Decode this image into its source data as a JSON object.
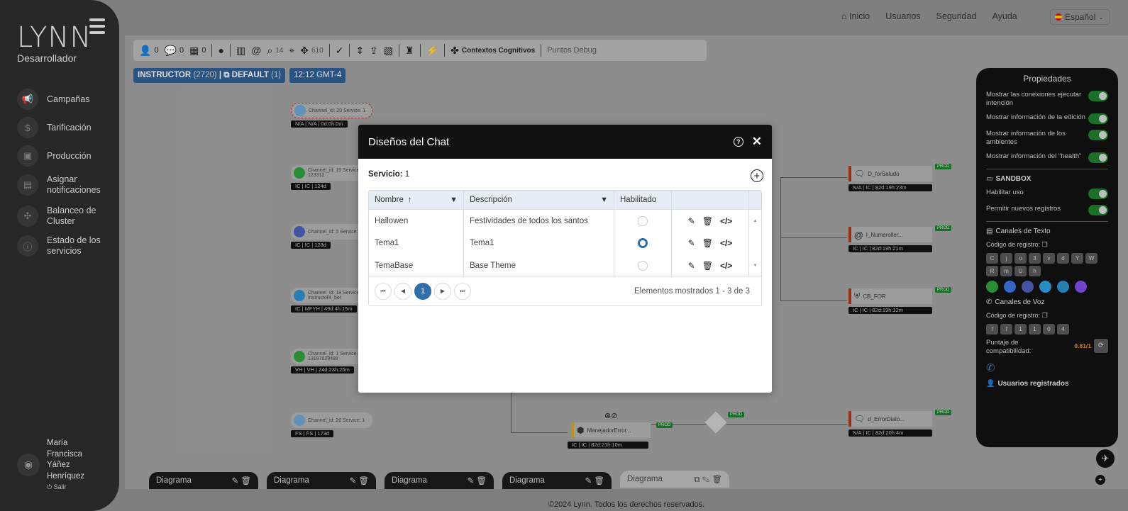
{
  "sidebar": {
    "logo": "LYNN",
    "role": "Desarrollador",
    "items": [
      {
        "label": "Campañas"
      },
      {
        "label": "Tarificación"
      },
      {
        "label": "Producción"
      },
      {
        "label": "Asignar notificaciones"
      },
      {
        "label": "Balanceo de Cluster"
      },
      {
        "label": "Estado de los servicios"
      }
    ],
    "user": {
      "name": "María Francisca Yáñez Henríquez",
      "logout": "Salir"
    }
  },
  "topnav": {
    "items": [
      "Inicio",
      "Usuarios",
      "Seguridad",
      "Ayuda"
    ],
    "language": "Español"
  },
  "toolbar": {
    "counters": [
      "0",
      "0",
      "0"
    ],
    "search_count": "14",
    "plugin_count": "610",
    "cognitive_contexts": "Contextos Cognitivos",
    "debug_points": "Puntos Debug"
  },
  "badges": {
    "instructor": "INSTRUCTOR",
    "instructor_id": "(2720)",
    "default": "DEFAULT",
    "default_id": "(1)",
    "time": "12:12 GMT-4"
  },
  "diagram": {
    "nodes": [
      {
        "label": "Channel_id: 20 Service: 1",
        "status": "N/A | N/A | 0d:0h:0m"
      },
      {
        "label": "Channel_id: 15 Service",
        "sub": "123312",
        "status": "IC | IC | 124d"
      },
      {
        "label": "Channel_id: 3 Service:",
        "status": "IC | IC | 123d"
      },
      {
        "label": "Channel_id: 18 Service",
        "sub": "Instructor4_bot",
        "status": "IC | MFYH | 49d:4h:15m"
      },
      {
        "label": "Channel_id: 1 Service:",
        "sub": "13197029488",
        "status": "VH | VH | 24d:23h:25m"
      },
      {
        "label": "Channel_id: 20 Service: 1",
        "status": "FS | FS | 173d"
      }
    ],
    "right_nodes": [
      {
        "label": "D_forSaludo",
        "status": "N/A | IC | 82d:19h:23m",
        "env": "PROD"
      },
      {
        "label": "I_Numeroller...",
        "status": "IC | IC | 82d:19h:21m",
        "env": "PROD"
      },
      {
        "label": "CB_FOR",
        "status": "IC | IC | 82d:19h:12m",
        "env": "PROD"
      },
      {
        "label": "d_ErrorDialo...",
        "status": "N/A | IC | 82d:20h:4m",
        "env": "PROD"
      }
    ],
    "error_node": {
      "label": "ManejadorError...",
      "status": "IC | IC | 82d:21h:10m",
      "env": "PROD"
    },
    "diamond_env": "PROD"
  },
  "properties": {
    "title": "Propiedades",
    "toggles": [
      {
        "label": "Mostrar las conexiones ejecutar intención"
      },
      {
        "label": "Mostrar información de la edición"
      },
      {
        "label": "Mostrar información de los ambientes"
      },
      {
        "label": "Mostrar información del \"health\""
      }
    ],
    "sandbox": {
      "title": "SANDBOX",
      "toggles": [
        {
          "label": "Habilitar uso"
        },
        {
          "label": "Permitir nuevos registros"
        }
      ]
    },
    "text_channels": {
      "title": "Canales de Texto",
      "code_label": "Código de registro:",
      "code": [
        "C",
        "j",
        "o",
        "3",
        "v",
        "d",
        "Y",
        "W",
        "R",
        "m",
        "U",
        "h"
      ]
    },
    "voice_channels": {
      "title": "Canales de Voz",
      "code_label": "Código de registro:",
      "code": [
        "7",
        "7",
        "1",
        "1",
        "0",
        "4"
      ]
    },
    "score_label": "Puntaje de compatibilidad:",
    "score": "0.81/1",
    "registered_users": "Usuarios registrados"
  },
  "tabs": [
    {
      "label": "Diagrama"
    },
    {
      "label": "Diagrama"
    },
    {
      "label": "Diagrama"
    },
    {
      "label": "Diagrama"
    },
    {
      "label": "Diagrama"
    }
  ],
  "footer": "©2024 Lynn. Todos los derechos reservados.",
  "modal": {
    "title": "Diseños del Chat",
    "service_label": "Servicio:",
    "service_value": "1",
    "columns": {
      "name": "Nombre",
      "description": "Descripción",
      "enabled": "Habilitado"
    },
    "rows": [
      {
        "name": "Hallowen",
        "description": "Festividades de todos los santos",
        "enabled": false
      },
      {
        "name": "Tema1",
        "description": "Tema1",
        "enabled": true
      },
      {
        "name": "TemaBase",
        "description": "Base Theme",
        "enabled": false
      }
    ],
    "pager": {
      "current": "1",
      "info": "Elementos mostrados 1 - 3 de 3"
    }
  }
}
